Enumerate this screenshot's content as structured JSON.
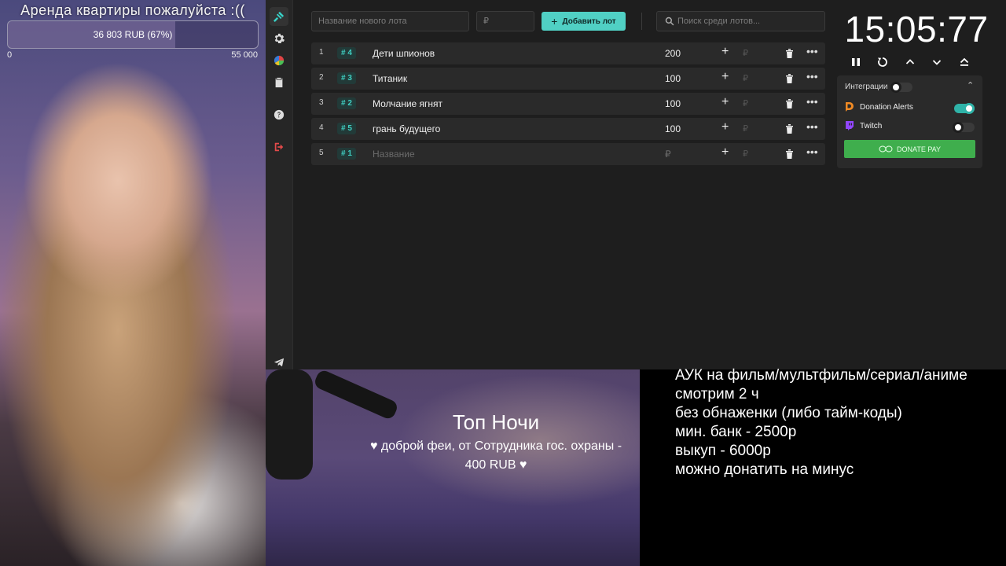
{
  "goal": {
    "title": "Аренда квартиры пожалуйста :((",
    "progress_text": "36 803 RUB (67%)",
    "progress_fraction": 0.67,
    "min_label": "0",
    "max_label": "55 000"
  },
  "toolbar": {
    "lot_name_placeholder": "Название нового лота",
    "amount_placeholder": "₽",
    "add_lot_label": "Добавить лот",
    "search_placeholder": "Поиск среди лотов..."
  },
  "lots": [
    {
      "index": "1",
      "fast_id": "# 4",
      "name": "Дети шпионов",
      "amount": "200",
      "extra": "₽"
    },
    {
      "index": "2",
      "fast_id": "# 3",
      "name": "Титаник",
      "amount": "100",
      "extra": "₽"
    },
    {
      "index": "3",
      "fast_id": "# 2",
      "name": "Молчание ягнят",
      "amount": "100",
      "extra": "₽"
    },
    {
      "index": "4",
      "fast_id": "# 5",
      "name": "грань будущего",
      "amount": "100",
      "extra": "₽"
    },
    {
      "index": "5",
      "fast_id": "# 1",
      "name_placeholder": "Название",
      "amount_placeholder": "₽",
      "extra": "₽"
    }
  ],
  "timer": {
    "value": "15:05:77"
  },
  "integrations": {
    "label": "Интеграции",
    "donation_alerts": {
      "label": "Donation Alerts",
      "enabled": true
    },
    "twitch": {
      "label": "Twitch",
      "enabled": false
    },
    "donate_pay_label": "DONATE PAY"
  },
  "overlay": {
    "title": "Топ Ночи",
    "line1": "♥ доброй феи, от Сотрудника гос. охраны -",
    "line2": "400 RUB ♥"
  },
  "rules": [
    "АУК на фильм/мультфильм/сериал/аниме",
    "смотрим 2 ч",
    "без обнаженки (либо тайм-коды)",
    "мин. банк - 2500р",
    "выкуп - 6000р",
    "можно донатить на минус"
  ],
  "colors": {
    "accent": "#50d0c4",
    "donate_pay": "#3fae4d",
    "background": "#1e1e1e"
  },
  "icons": {
    "sidebar": [
      "auction-icon",
      "gear-icon",
      "pie-chart-icon",
      "clipboard-icon",
      "help-icon",
      "logout-icon",
      "telegram-icon"
    ]
  }
}
